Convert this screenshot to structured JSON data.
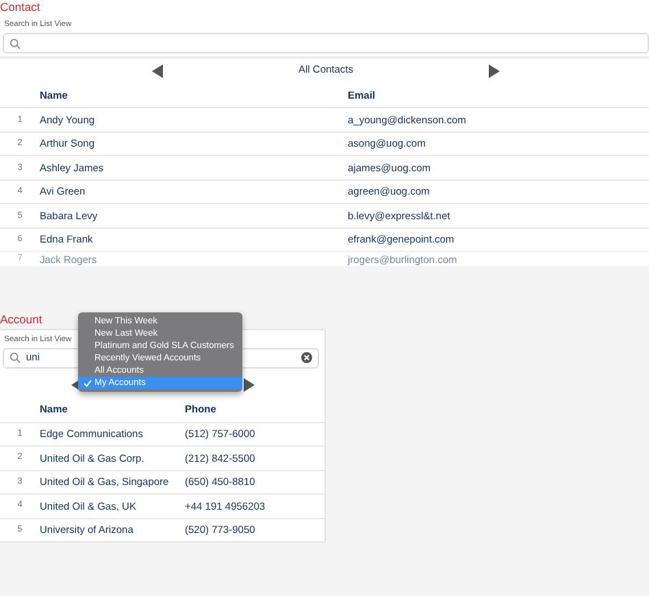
{
  "contact": {
    "title": "Contact",
    "search_label": "Search in List View",
    "view": "All Contacts",
    "columns": [
      "Name",
      "Email"
    ],
    "rows": [
      {
        "num": "1",
        "name": "Andy Young",
        "value": "a_young@dickenson.com"
      },
      {
        "num": "2",
        "name": "Arthur Song",
        "value": "asong@uog.com"
      },
      {
        "num": "3",
        "name": "Ashley James",
        "value": "ajames@uog.com"
      },
      {
        "num": "4",
        "name": "Avi Green",
        "value": "agreen@uog.com"
      },
      {
        "num": "5",
        "name": "Babara Levy",
        "value": "b.levy@expressl&t.net"
      },
      {
        "num": "6",
        "name": "Edna Frank",
        "value": "efrank@genepoint.com"
      },
      {
        "num": "7",
        "name": "Jack Rogers",
        "value": "jrogers@burlington.com",
        "faded": true
      }
    ]
  },
  "account": {
    "title": "Account",
    "search_label": "Search in List View",
    "search_value": "uni",
    "menu": [
      {
        "label": "New This Week",
        "selected": false
      },
      {
        "label": "New Last Week",
        "selected": false
      },
      {
        "label": "Platinum and Gold SLA Customers",
        "selected": false
      },
      {
        "label": "Recently Viewed Accounts",
        "selected": false
      },
      {
        "label": "All Accounts",
        "selected": false
      },
      {
        "label": "My Accounts",
        "selected": true
      }
    ],
    "columns": [
      "Name",
      "Phone"
    ],
    "rows": [
      {
        "num": "1",
        "name": "Edge Communications",
        "value": "(512) 757-6000"
      },
      {
        "num": "2",
        "name": "United Oil & Gas Corp.",
        "value": "(212) 842-5500"
      },
      {
        "num": "3",
        "name": "United Oil & Gas, Singapore",
        "value": "(650) 450-8810"
      },
      {
        "num": "4",
        "name": "United Oil & Gas, UK",
        "value": "+44 191 4956203"
      },
      {
        "num": "5",
        "name": "University of Arizona",
        "value": "(520) 773-9050"
      }
    ]
  }
}
